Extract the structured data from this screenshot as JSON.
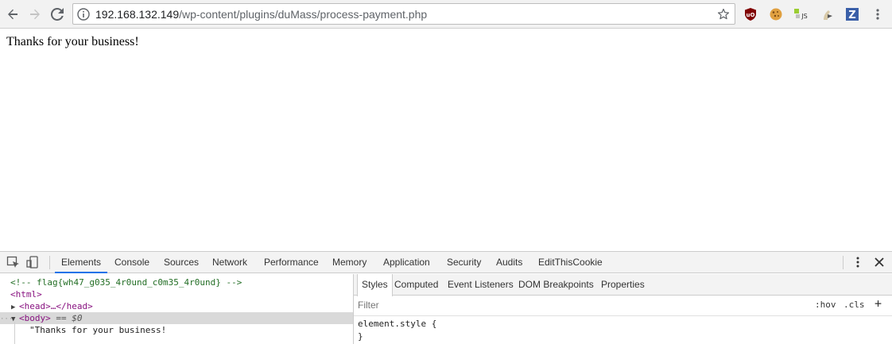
{
  "browser": {
    "url_host": "192.168.132.149",
    "url_path": "/wp-content/plugins/duMass/process-payment.php",
    "extensions": [
      "ublock-icon",
      "cookie-icon",
      "js-icon",
      "stylus-icon",
      "zotero-icon"
    ],
    "ublock_badge": "uO",
    "js_badge": "JS",
    "zotero_badge": "Z"
  },
  "page": {
    "body_text": "Thanks for your business!"
  },
  "devtools": {
    "tabs": [
      "Elements",
      "Console",
      "Sources",
      "Network",
      "Performance",
      "Memory",
      "Application",
      "Security",
      "Audits",
      "EditThisCookie"
    ],
    "active_tab": "Elements",
    "dom": {
      "comment": "<!-- flag{wh47_g035_4r0und_c0m35_4r0und} -->",
      "html_open": "<html>",
      "head_collapsed": "<head>…</head>",
      "body_open": "<body>",
      "body_marker": "== $0",
      "body_text": "\"Thanks for your business!"
    },
    "styles_tabs": [
      "Styles",
      "Computed",
      "Event Listeners",
      "DOM Breakpoints",
      "Properties"
    ],
    "filter_placeholder": "Filter",
    "hov_label": ":hov",
    "cls_label": ".cls",
    "add_label": "+",
    "element_style_open": "element.style {",
    "element_style_close": "}"
  },
  "colors": {
    "accent": "#1a73e8",
    "comment": "#236e25",
    "tag": "#881280",
    "ublock": "#800000",
    "zotero": "#3a5fa8"
  }
}
